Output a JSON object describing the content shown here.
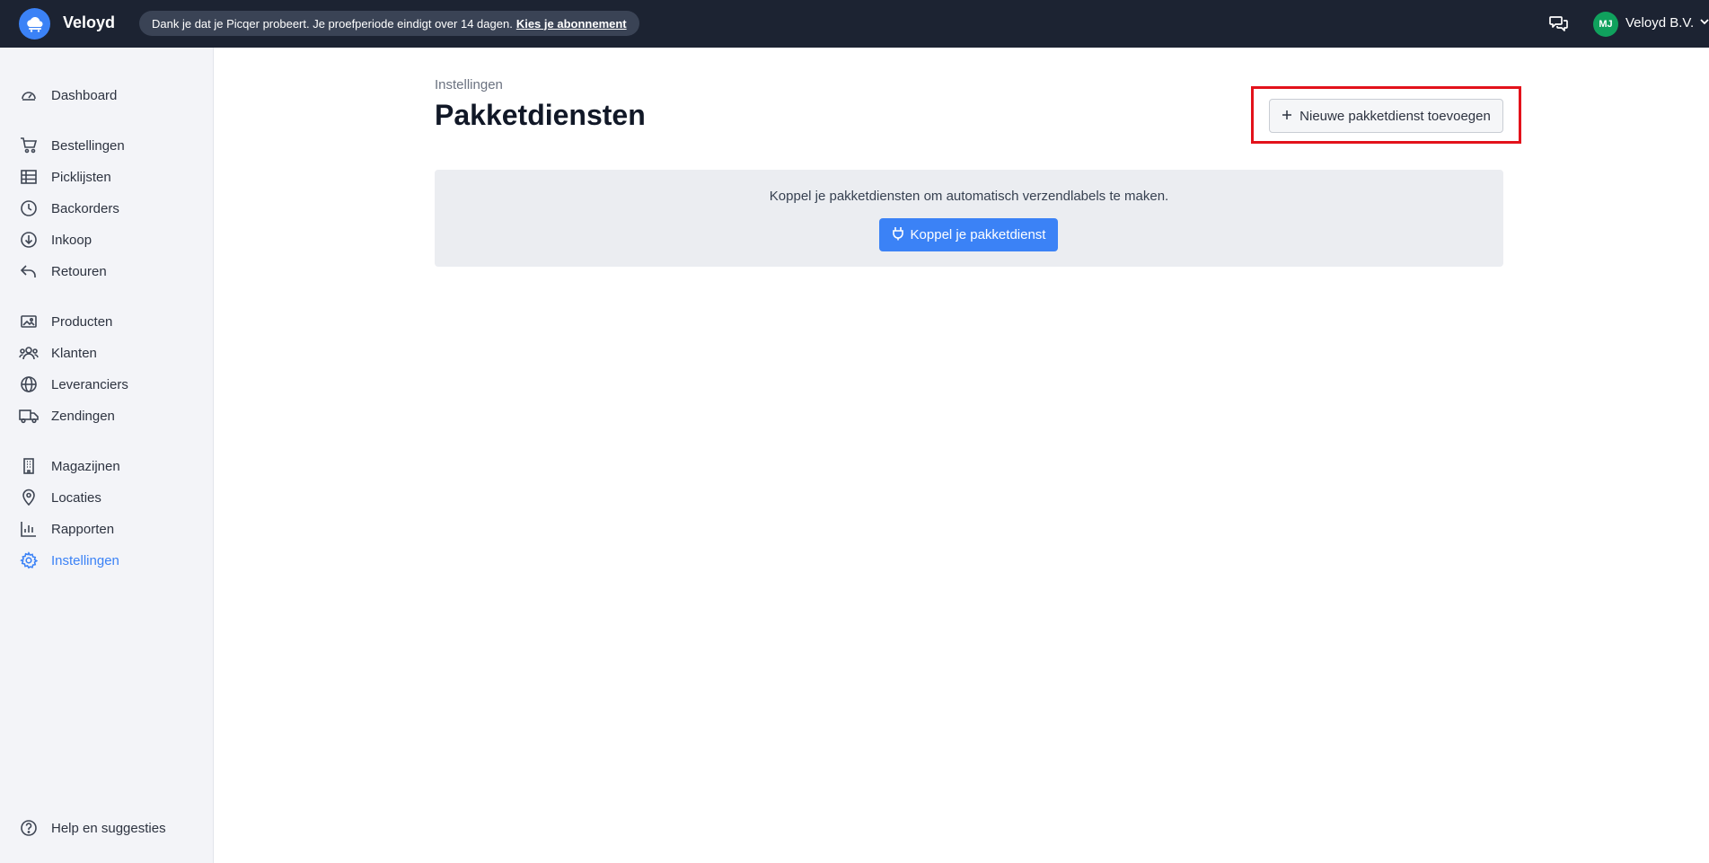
{
  "topbar": {
    "brand": "Veloyd",
    "trial_text": "Dank je dat je Picqer probeert. Je proefperiode eindigt over 14 dagen.",
    "trial_link": "Kies je abonnement",
    "avatar_initials": "MJ",
    "account_name": "Veloyd B.V."
  },
  "sidebar": {
    "items": [
      {
        "label": "Dashboard",
        "icon": "dashboard-icon"
      },
      {
        "label": "Bestellingen",
        "icon": "cart-icon"
      },
      {
        "label": "Picklijsten",
        "icon": "table-icon"
      },
      {
        "label": "Backorders",
        "icon": "clock-icon"
      },
      {
        "label": "Inkoop",
        "icon": "download-circle-icon"
      },
      {
        "label": "Retouren",
        "icon": "return-icon"
      },
      {
        "label": "Producten",
        "icon": "image-icon"
      },
      {
        "label": "Klanten",
        "icon": "users-icon"
      },
      {
        "label": "Leveranciers",
        "icon": "globe-icon"
      },
      {
        "label": "Zendingen",
        "icon": "truck-icon"
      },
      {
        "label": "Magazijnen",
        "icon": "building-icon"
      },
      {
        "label": "Locaties",
        "icon": "map-pin-icon"
      },
      {
        "label": "Rapporten",
        "icon": "bar-chart-icon"
      },
      {
        "label": "Instellingen",
        "icon": "gear-icon",
        "active": true
      }
    ],
    "help": {
      "label": "Help en suggesties",
      "icon": "help-icon"
    }
  },
  "main": {
    "breadcrumb": "Instellingen",
    "title": "Pakketdiensten",
    "add_button": "Nieuwe pakketdienst toevoegen",
    "empty_message": "Koppel je pakketdiensten om automatisch verzendlabels te maken.",
    "connect_button": "Koppel je pakketdienst"
  },
  "colors": {
    "topbar_bg": "#1c2332",
    "accent": "#3b82f6",
    "avatar_bg": "#10a15d",
    "highlight": "#e3121b",
    "sidebar_bg": "#f3f4f8"
  }
}
